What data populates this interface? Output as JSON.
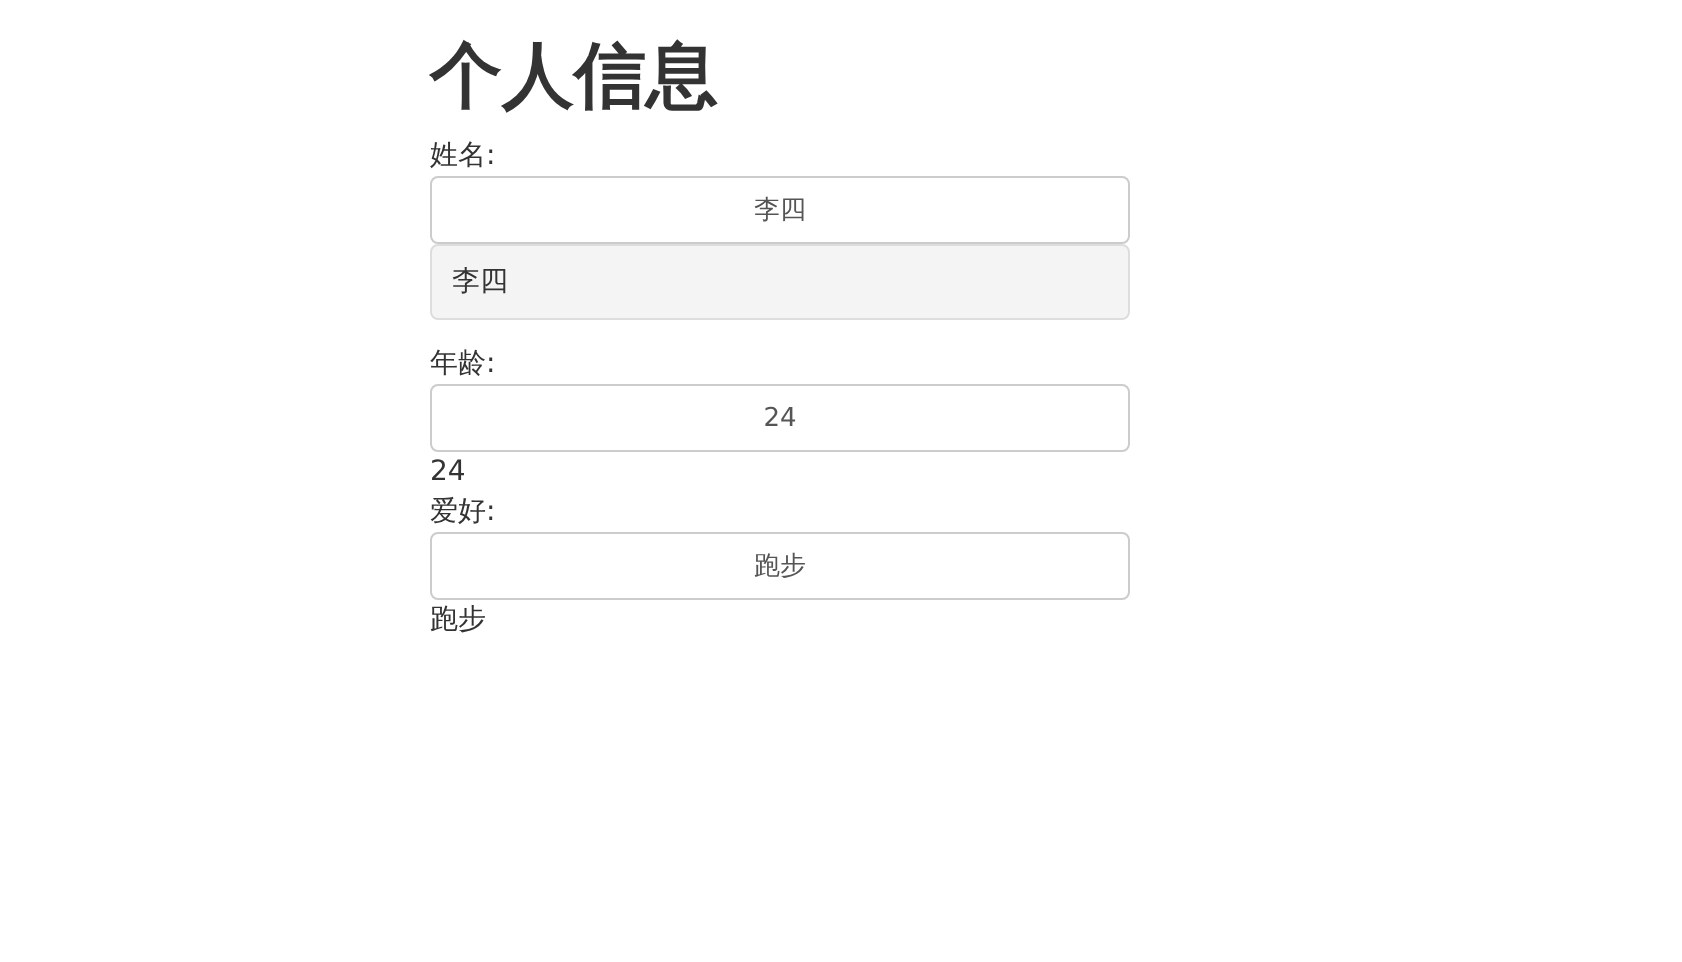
{
  "title": "个人信息",
  "fields": [
    {
      "label": "姓名:",
      "value": "李四",
      "output": "李四",
      "kind": "box"
    },
    {
      "label": "年龄:",
      "value": "24",
      "output": "24",
      "kind": "text"
    },
    {
      "label": "爱好:",
      "value": "跑步",
      "output": "跑步",
      "kind": "text"
    }
  ]
}
